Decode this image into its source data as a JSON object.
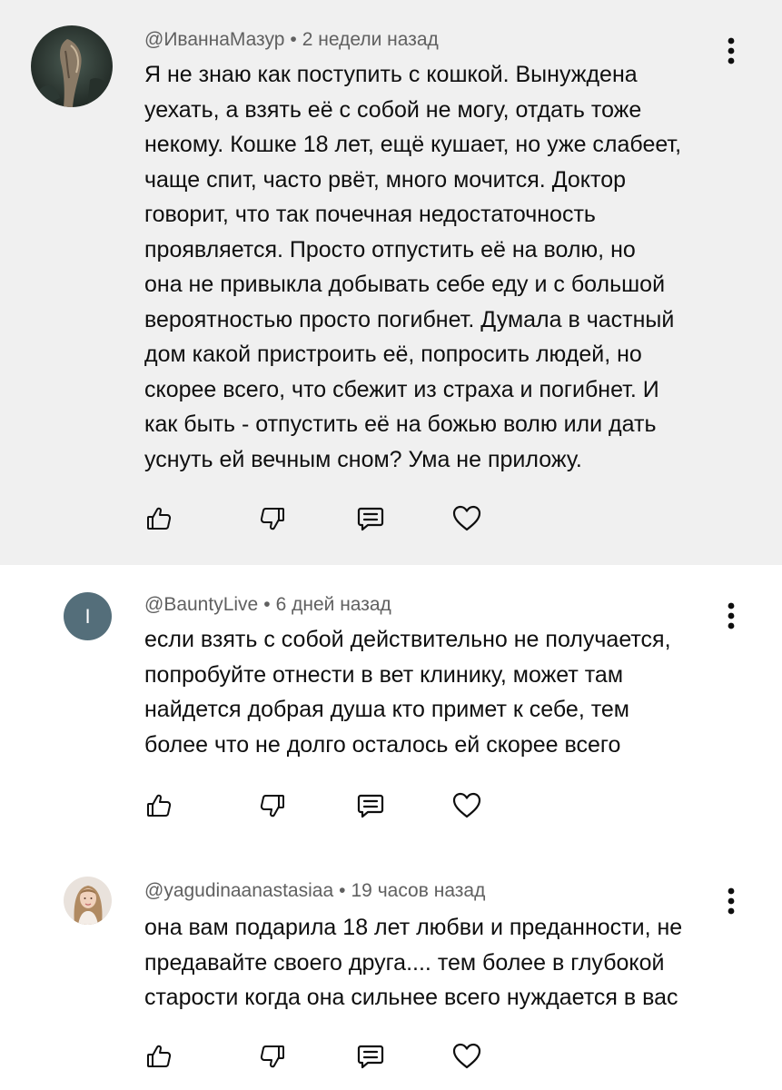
{
  "comments": [
    {
      "author": "@ИваннаМазур",
      "separator": "•",
      "time": "2 недели назад",
      "lines": [
        "Я не знаю как поступить с  кошкой. Вынуждена",
        "уехать, а взять её с собой не могу, отдать тоже",
        "некому. Кошке 18 лет, ещё кушает, но уже слабеет,",
        "чаще спит, часто рвёт, много мочится. Доктор",
        "говорит, что так почечная недостаточность",
        "проявляется. Просто отпустить её на волю, но",
        "она не привыкла добывать себе еду и с большой",
        "вероятностью просто погибнет. Думала в частный",
        "дом какой пристроить её, попросить людей, но",
        "скорее всего, что сбежит из страха и погибнет. И",
        "как быть - отпустить её на божью волю или  дать",
        "уснуть ей вечным сном? Ума не приложу."
      ],
      "avatar_icon": "photo-avatar-icon"
    },
    {
      "author": "@BauntyLive",
      "separator": "•",
      "time": "6 дней назад",
      "avatar_letter": "I",
      "avatar_color": "#546e7a",
      "lines": [
        "если взять с собой действительно не получается,",
        "попробуйте отнести в вет клинику, может там",
        "найдется добрая душа кто примет к себе, тем",
        "более что не долго осталось  ей скорее всего"
      ]
    },
    {
      "author": "@yagudinaanastasiaa",
      "separator": "•",
      "time": "19 часов назад",
      "lines": [
        "она вам подарила 18 лет любви и преданности,  не",
        "предавайте своего друга.... тем более в глубокой",
        "старости когда она сильнее всего нуждается в вас"
      ],
      "avatar_icon": "photo-avatar-icon"
    }
  ],
  "icons": {
    "like": "thumb-up-icon",
    "dislike": "thumb-down-icon",
    "reply": "reply-comment-icon",
    "heart": "heart-icon",
    "more": "more-vertical-icon"
  },
  "colors": {
    "highlight_bg": "#f0f0f0",
    "meta_text": "#606060",
    "body_text": "#0f0f0f"
  }
}
